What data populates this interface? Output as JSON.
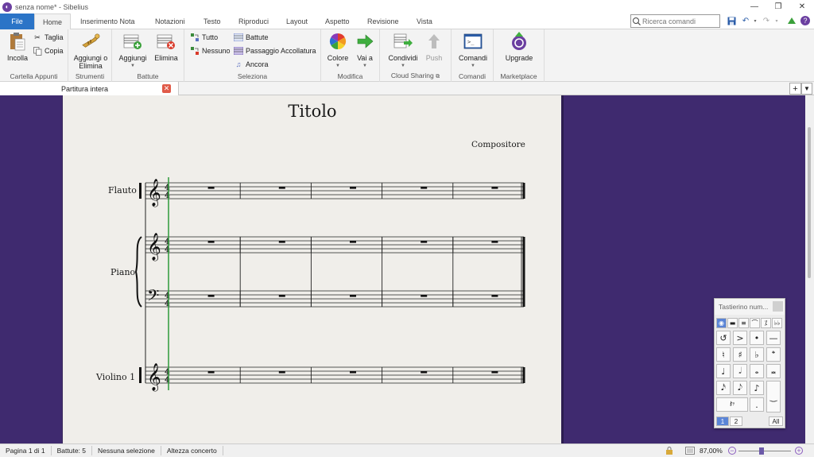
{
  "window": {
    "title": "senza nome* - Sibelius",
    "controls": [
      "minimize",
      "restore",
      "close"
    ]
  },
  "ribbon": {
    "tabs": [
      {
        "label": "File",
        "active": false
      },
      {
        "label": "Home",
        "active": true
      },
      {
        "label": "Inserimento Nota",
        "active": false
      },
      {
        "label": "Notazioni",
        "active": false
      },
      {
        "label": "Testo",
        "active": false
      },
      {
        "label": "Riproduci",
        "active": false
      },
      {
        "label": "Layout",
        "active": false
      },
      {
        "label": "Aspetto",
        "active": false
      },
      {
        "label": "Revisione",
        "active": false
      },
      {
        "label": "Vista",
        "active": false
      }
    ],
    "search_placeholder": "Ricerca comandi",
    "groups": {
      "clipboard": {
        "label": "Cartella Appunti",
        "paste": "Incolla",
        "cut": "Taglia",
        "copy": "Copia"
      },
      "tools": {
        "label": "Strumenti",
        "add_remove": "Aggiungi o Elimina"
      },
      "bars": {
        "label": "Battute",
        "add": "Aggiungi",
        "delete": "Elimina"
      },
      "select": {
        "label": "Seleziona",
        "all": "Tutto",
        "none": "Nessuno",
        "bars": "Battute",
        "system_passage": "Passaggio Accollatura",
        "more": "Ancora"
      },
      "edit": {
        "label": "Modifica",
        "color": "Colore",
        "goto": "Vai a"
      },
      "cloud": {
        "label": "Cloud Sharing",
        "share": "Condividi",
        "push": "Push"
      },
      "commands": {
        "label": "Comandi",
        "commands": "Comandi"
      },
      "marketplace": {
        "label": "Marketplace",
        "upgrade": "Upgrade"
      }
    }
  },
  "document_tab": {
    "label": "Partitura intera"
  },
  "score": {
    "title": "Titolo",
    "composer": "Compositore",
    "time_signature": "4/4",
    "instruments": [
      "Flauto",
      "Piano",
      "Violino 1"
    ],
    "bars_per_system": 5
  },
  "keypad": {
    "title": "Tastierino num...",
    "layout_tabs": [
      "1",
      "2",
      "All"
    ],
    "top_row": [
      "whole-note-layout",
      "rests",
      "tremolo",
      "fermata",
      "repeat",
      "double-flat"
    ],
    "keys": [
      "↺",
      ">",
      "•",
      "—",
      "♮",
      "♯",
      "♭",
      "𝄌",
      "♩",
      "𝅗𝅥",
      "𝅝",
      "𝅜",
      "𝅘𝅥𝅯",
      "𝅘𝅥𝅮",
      "♪",
      "‿",
      "𝄽𝄾",
      "."
    ]
  },
  "statusbar": {
    "page": "Pagina 1 di 1",
    "bars": "Battute: 5",
    "selection": "Nessuna selezione",
    "pitch": "Altezza concerto",
    "zoom": "87,00%"
  },
  "colors": {
    "accent": "#2b74c7",
    "workspace": "#3f2a6f",
    "paper": "#f0eeea",
    "playback_line": "#2e9a3a",
    "close_tab": "#e05a48"
  }
}
